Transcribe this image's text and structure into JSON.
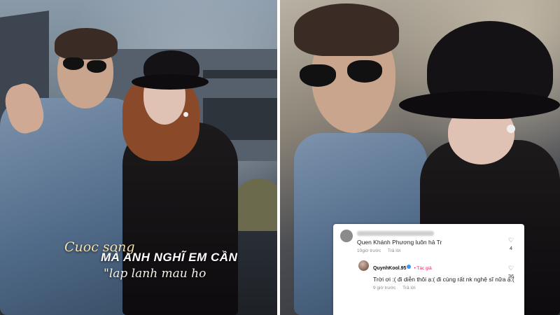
{
  "left_photo": {
    "lyrics": {
      "script_text": "Cuoc song",
      "line1": "MÀ ANH NGHĨ EM CẦN",
      "line2": "\"lap lanh mau ho"
    }
  },
  "comment_overlay": {
    "comments": [
      {
        "text": "Quen Khánh Phương luôn hả Tr",
        "time": "10giờ trước",
        "reply_label": "Trả lời",
        "likes": "4"
      },
      {
        "username": "QuynhKool.95",
        "author_badge": "• Tác giả",
        "text": "Trời ơi :( đi diễn thôi ạ:( đi cùng rất nk nghệ sĩ nữa ạ:(",
        "time": "9 giờ trước",
        "reply_label": "Trả lời",
        "likes": "36"
      }
    ]
  }
}
